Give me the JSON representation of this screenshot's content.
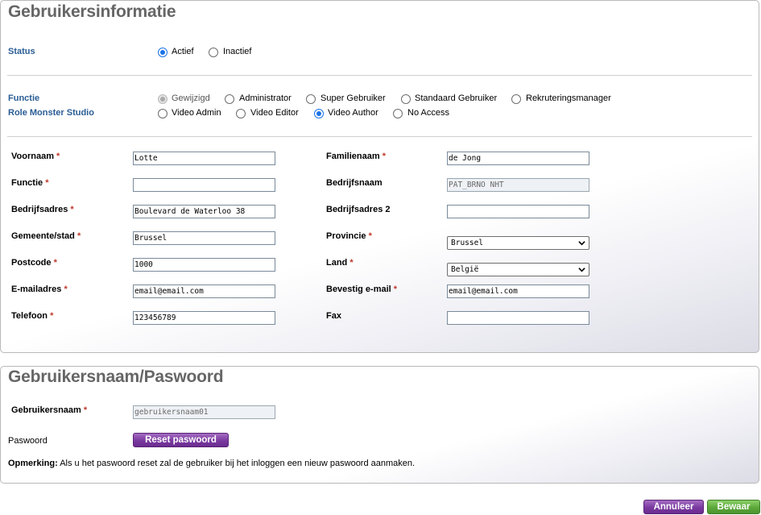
{
  "user_info": {
    "title": "Gebruikersinformatie",
    "status": {
      "label": "Status",
      "options": [
        {
          "label": "Actief",
          "checked": true
        },
        {
          "label": "Inactief",
          "checked": false
        }
      ]
    },
    "functie": {
      "label": "Functie",
      "options": [
        {
          "label": "Gewijzigd",
          "checked": true,
          "disabled": true
        },
        {
          "label": "Administrator",
          "checked": false
        },
        {
          "label": "Super Gebruiker",
          "checked": false
        },
        {
          "label": "Standaard Gebruiker",
          "checked": false
        },
        {
          "label": "Rekruteringsmanager",
          "checked": false
        }
      ]
    },
    "role_monster": {
      "label": "Role Monster Studio",
      "options": [
        {
          "label": "Video Admin",
          "checked": false
        },
        {
          "label": "Video Editor",
          "checked": false
        },
        {
          "label": "Video Author",
          "checked": true
        },
        {
          "label": "No Access",
          "checked": false
        }
      ]
    },
    "fields": {
      "voornaam": {
        "label": "Voornaam",
        "required": "*",
        "value": "Lotte"
      },
      "familienaam": {
        "label": "Familienaam",
        "required": "*",
        "value": "de Jong"
      },
      "functie": {
        "label": "Functie",
        "required": "*",
        "value": ""
      },
      "bedrijfsnaam": {
        "label": "Bedrijfsnaam",
        "value": "PAT_BRNO NHT"
      },
      "bedrijfsadres": {
        "label": "Bedrijfsadres",
        "required": "*",
        "value": "Boulevard de Waterloo 38"
      },
      "bedrijfsadres2": {
        "label": "Bedrijfsadres 2",
        "value": ""
      },
      "gemeente": {
        "label": "Gemeente/stad",
        "required": "*",
        "value": "Brussel"
      },
      "provincie": {
        "label": "Provincie",
        "required": "*",
        "value": "Brussel"
      },
      "postcode": {
        "label": "Postcode",
        "required": "*",
        "value": "1000"
      },
      "land": {
        "label": "Land",
        "required": "*",
        "value": "België"
      },
      "email": {
        "label": "E-mailadres",
        "required": "*",
        "value": "email@email.com"
      },
      "bevestig_email": {
        "label": "Bevestig e-mail",
        "required": "*",
        "value": "email@email.com"
      },
      "telefoon": {
        "label": "Telefoon",
        "required": "*",
        "value": "123456789"
      },
      "fax": {
        "label": "Fax",
        "value": ""
      }
    }
  },
  "credentials": {
    "title": "Gebruikersnaam/Paswoord",
    "username": {
      "label": "Gebruikersnaam",
      "required": "*",
      "value": "gebruikersnaam01"
    },
    "password": {
      "label": "Paswoord",
      "button": "Reset paswoord"
    },
    "note": {
      "bold": "Opmerking:",
      "text": "Als u het paswoord reset zal de gebruiker bij het inloggen een nieuw paswoord aanmaken."
    }
  },
  "actions": {
    "cancel": "Annuleer",
    "save": "Bewaar"
  },
  "colors": {
    "accent_blue": "#2a5d94",
    "required_red": "#c0392b",
    "purple_button": "#7a3aa0",
    "green_button": "#5ca83a",
    "radio_checked": "#1a73e8"
  }
}
